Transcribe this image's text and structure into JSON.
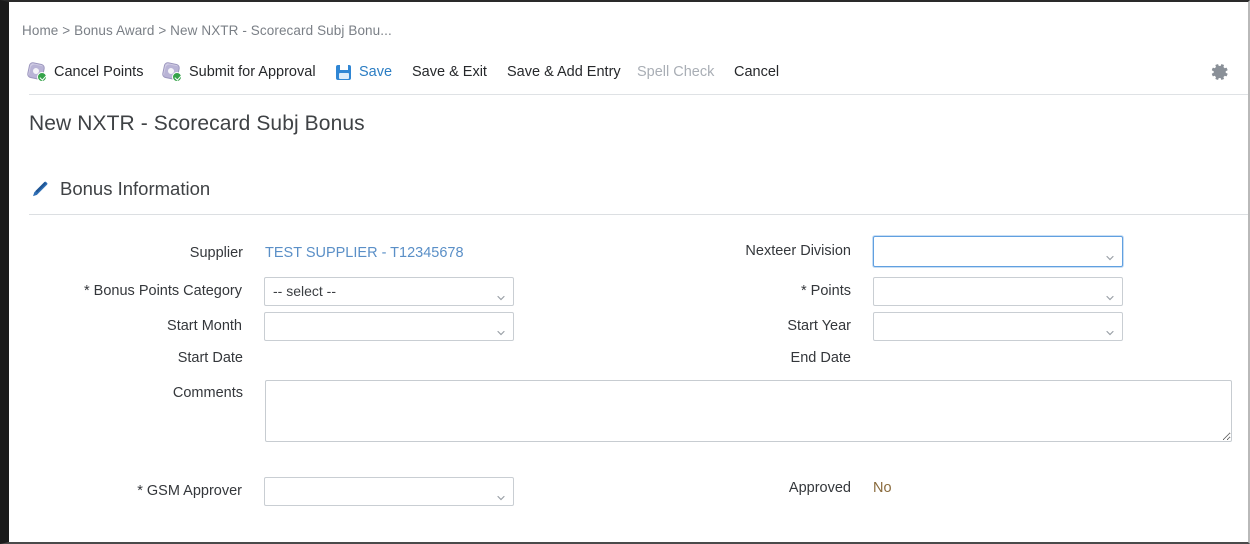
{
  "breadcrumb": {
    "text": "Home > Bonus Award > New NXTR - Scorecard Subj Bonu..."
  },
  "toolbar": {
    "cancel_points": "Cancel Points",
    "submit_for_approval": "Submit for Approval",
    "save": "Save",
    "save_and_exit": "Save & Exit",
    "save_and_add_entry": "Save & Add Entry",
    "spell_check": "Spell Check",
    "cancel": "Cancel",
    "settings_icon": "gear-icon"
  },
  "page": {
    "title": "New NXTR - Scorecard Subj Bonus"
  },
  "section": {
    "icon": "pencil-icon",
    "title": "Bonus Information"
  },
  "form": {
    "supplier": {
      "label": "Supplier",
      "value": "TEST SUPPLIER - T12345678"
    },
    "nexteer_division": {
      "label": "Nexteer Division",
      "value": "",
      "options": [
        ""
      ]
    },
    "bonus_points_category": {
      "label": "* Bonus Points Category",
      "value": "-- select --",
      "options": [
        "-- select --"
      ]
    },
    "points": {
      "label": "* Points",
      "value": "",
      "options": [
        ""
      ]
    },
    "start_month": {
      "label": "Start Month",
      "value": "",
      "options": [
        ""
      ]
    },
    "start_year": {
      "label": "Start Year",
      "value": "",
      "options": [
        ""
      ]
    },
    "start_date": {
      "label": "Start Date",
      "value": ""
    },
    "end_date": {
      "label": "End Date",
      "value": ""
    },
    "comments": {
      "label": "Comments",
      "value": "",
      "placeholder": ""
    },
    "gsm_approver": {
      "label": "* GSM Approver",
      "value": "",
      "options": [
        ""
      ]
    },
    "approved": {
      "label": "Approved",
      "value": "No"
    }
  },
  "colors": {
    "link": "#5a8fc7",
    "save_blue": "#2b7dc3",
    "disabled_gray": "#a9aeb5",
    "focus_border": "#61a0e0"
  }
}
